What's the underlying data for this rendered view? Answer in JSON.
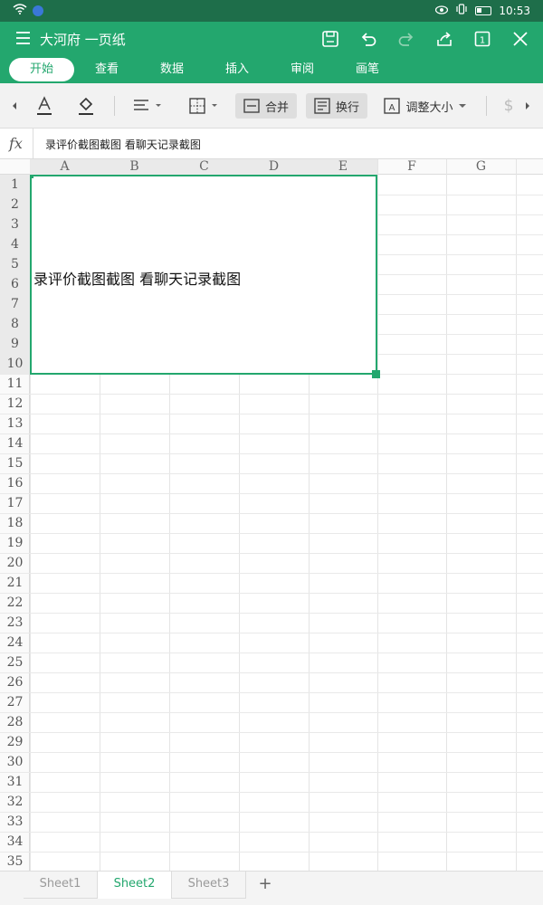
{
  "status_bar": {
    "time": "10:53",
    "battery_level": 0.3
  },
  "title_bar": {
    "document_title": "大河府 一页纸"
  },
  "ribbon_tabs": [
    {
      "label": "开始",
      "active": true
    },
    {
      "label": "查看",
      "active": false
    },
    {
      "label": "数据",
      "active": false
    },
    {
      "label": "插入",
      "active": false
    },
    {
      "label": "审阅",
      "active": false
    },
    {
      "label": "画笔",
      "active": false
    }
  ],
  "toolbar": {
    "merge_label": "合并",
    "wrap_label": "换行",
    "resize_label": "调整大小",
    "currency_symbol": "$"
  },
  "formula_bar": {
    "fx_label": "fx",
    "value": "录评价截图截图 看聊天记录截图"
  },
  "grid": {
    "columns": [
      "A",
      "B",
      "C",
      "D",
      "E",
      "F",
      "G"
    ],
    "rows": [
      "1",
      "2",
      "3",
      "4",
      "5",
      "6",
      "7",
      "8",
      "9",
      "10",
      "11",
      "12",
      "13",
      "14",
      "15",
      "16",
      "17",
      "18",
      "19",
      "20",
      "21",
      "22",
      "23",
      "24",
      "25",
      "26",
      "27",
      "28",
      "29",
      "30",
      "31",
      "32",
      "33",
      "34",
      "35"
    ],
    "selection": "A1:E10",
    "merged_cell_text": "录评价截图截图 看聊天记录截图"
  },
  "sheet_tabs": {
    "tabs": [
      {
        "label": "Sheet1",
        "active": false
      },
      {
        "label": "Sheet2",
        "active": true
      },
      {
        "label": "Sheet3",
        "active": false
      }
    ],
    "add_label": "+"
  },
  "colors": {
    "accent": "#23a76e",
    "status_bar": "#1e6e4a"
  }
}
